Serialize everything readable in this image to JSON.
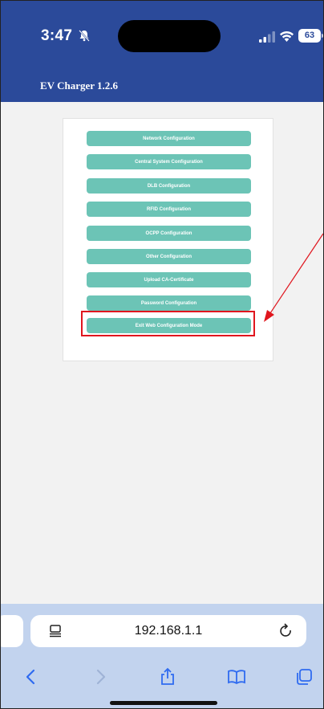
{
  "status_bar": {
    "time": "3:47",
    "battery": "63"
  },
  "header": {
    "title": "EV Charger 1.2.6"
  },
  "menu": {
    "items": [
      {
        "label": "Network Configuration"
      },
      {
        "label": "Central System Configuration"
      },
      {
        "label": "DLB Configuration"
      },
      {
        "label": "RFID Configuration"
      },
      {
        "label": "OCPP Configuration"
      },
      {
        "label": "Other Configuration"
      },
      {
        "label": "Upload CA-Certificate"
      },
      {
        "label": "Password Configuration"
      },
      {
        "label": "Exit Web Configuration Mode"
      }
    ]
  },
  "browser": {
    "url": "192.168.1.1"
  },
  "colors": {
    "header_bg": "#2b4a9a",
    "button_bg": "#6cc4b6",
    "highlight": "#e0161e",
    "browser_bar": "#c2d3ee"
  },
  "icons": [
    "bell-slash-icon",
    "signal-icon",
    "wifi-icon",
    "battery-icon",
    "page-icon",
    "reload-icon",
    "back-icon",
    "forward-icon",
    "share-icon",
    "bookmarks-icon",
    "tabs-icon"
  ]
}
